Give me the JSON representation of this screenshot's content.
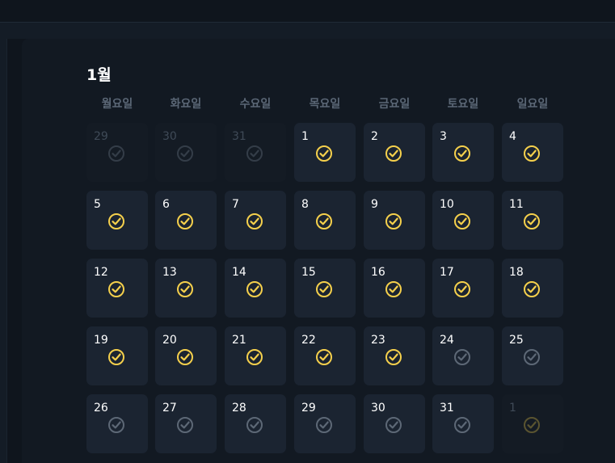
{
  "calendar": {
    "month_title": "1월",
    "weekdays": [
      "월요일",
      "화요일",
      "수요일",
      "목요일",
      "금요일",
      "토요일",
      "일요일"
    ],
    "colors": {
      "checked": "#f5d04c",
      "unchecked": "#5d6876",
      "outside": "#343d48",
      "outside_checked": "#5a5430"
    },
    "weeks": [
      [
        {
          "day": "29",
          "status": "outside"
        },
        {
          "day": "30",
          "status": "outside"
        },
        {
          "day": "31",
          "status": "outside"
        },
        {
          "day": "1",
          "status": "checked"
        },
        {
          "day": "2",
          "status": "checked"
        },
        {
          "day": "3",
          "status": "checked"
        },
        {
          "day": "4",
          "status": "checked"
        }
      ],
      [
        {
          "day": "5",
          "status": "checked"
        },
        {
          "day": "6",
          "status": "checked"
        },
        {
          "day": "7",
          "status": "checked"
        },
        {
          "day": "8",
          "status": "checked"
        },
        {
          "day": "9",
          "status": "checked"
        },
        {
          "day": "10",
          "status": "checked"
        },
        {
          "day": "11",
          "status": "checked"
        }
      ],
      [
        {
          "day": "12",
          "status": "checked"
        },
        {
          "day": "13",
          "status": "checked"
        },
        {
          "day": "14",
          "status": "checked"
        },
        {
          "day": "15",
          "status": "checked"
        },
        {
          "day": "16",
          "status": "checked"
        },
        {
          "day": "17",
          "status": "checked"
        },
        {
          "day": "18",
          "status": "checked"
        }
      ],
      [
        {
          "day": "19",
          "status": "checked"
        },
        {
          "day": "20",
          "status": "checked"
        },
        {
          "day": "21",
          "status": "checked"
        },
        {
          "day": "22",
          "status": "checked"
        },
        {
          "day": "23",
          "status": "checked"
        },
        {
          "day": "24",
          "status": "unchecked"
        },
        {
          "day": "25",
          "status": "unchecked"
        }
      ],
      [
        {
          "day": "26",
          "status": "unchecked"
        },
        {
          "day": "27",
          "status": "unchecked"
        },
        {
          "day": "28",
          "status": "unchecked"
        },
        {
          "day": "29",
          "status": "unchecked"
        },
        {
          "day": "30",
          "status": "unchecked"
        },
        {
          "day": "31",
          "status": "unchecked"
        },
        {
          "day": "1",
          "status": "outside-checked"
        }
      ]
    ]
  }
}
